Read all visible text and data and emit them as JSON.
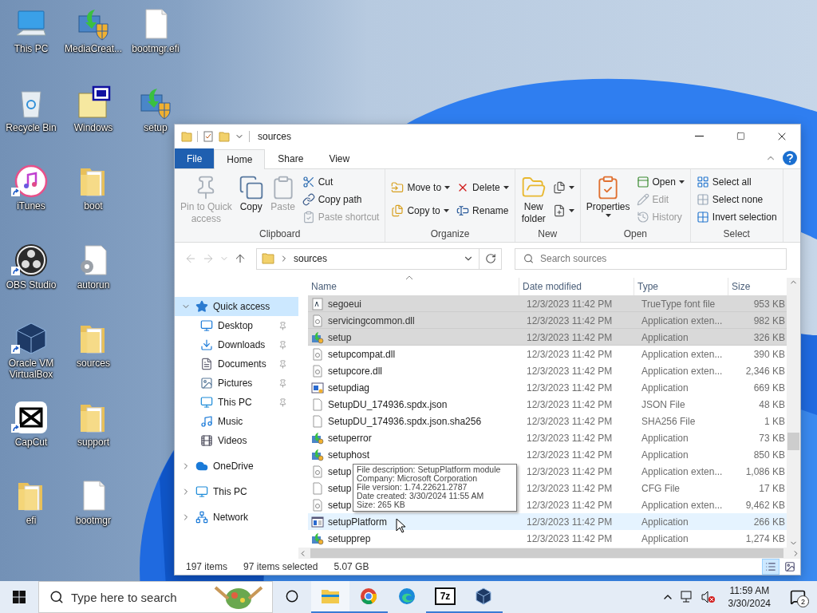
{
  "desktop": {
    "icons": [
      {
        "label": "This PC",
        "kind": "pc",
        "shortcut": false
      },
      {
        "label": "Recycle Bin",
        "kind": "recycle",
        "shortcut": false
      },
      {
        "label": "iTunes",
        "kind": "music",
        "shortcut": true
      },
      {
        "label": "OBS Studio",
        "kind": "obs",
        "shortcut": true
      },
      {
        "label": "Oracle VM VirtualBox",
        "kind": "vbox",
        "shortcut": true
      },
      {
        "label": "CapCut",
        "kind": "capcut",
        "shortcut": true
      },
      {
        "label": "efi",
        "kind": "folder",
        "shortcut": false
      },
      {
        "label": "MediaCreat...",
        "kind": "installer",
        "shortcut": false
      },
      {
        "label": "Windows",
        "kind": "iso",
        "shortcut": false
      },
      {
        "label": "boot",
        "kind": "folder",
        "shortcut": false
      },
      {
        "label": "autorun",
        "kind": "gearfile",
        "shortcut": false
      },
      {
        "label": "sources",
        "kind": "folder",
        "shortcut": false
      },
      {
        "label": "support",
        "kind": "folder",
        "shortcut": false
      },
      {
        "label": "bootmgr",
        "kind": "file",
        "shortcut": false
      },
      {
        "label": "bootmgr.efi",
        "kind": "file",
        "shortcut": false
      },
      {
        "label": "setup",
        "kind": "installer",
        "shortcut": false
      }
    ]
  },
  "window": {
    "title": "sources",
    "tabs": [
      {
        "label": "File",
        "kind": "file",
        "selected": false
      },
      {
        "label": "Home",
        "kind": "tab",
        "selected": true
      },
      {
        "label": "Share",
        "kind": "tab",
        "selected": false
      },
      {
        "label": "View",
        "kind": "tab",
        "selected": false
      }
    ],
    "ribbon": {
      "groups": [
        {
          "label": "Clipboard",
          "columns": [
            {
              "kind": "large",
              "buttons": [
                {
                  "lines": [
                    "Pin to Quick",
                    "access"
                  ],
                  "disabled": true,
                  "dropdown": false
                }
              ]
            },
            {
              "kind": "large",
              "buttons": [
                {
                  "lines": [
                    "Copy"
                  ],
                  "disabled": false,
                  "dropdown": false
                }
              ]
            },
            {
              "kind": "large",
              "buttons": [
                {
                  "lines": [
                    "Paste"
                  ],
                  "disabled": true,
                  "dropdown": false
                }
              ]
            },
            {
              "kind": "small",
              "buttons": [
                {
                  "label": "Cut",
                  "disabled": false,
                  "dropdown": false
                },
                {
                  "label": "Copy path",
                  "disabled": false,
                  "dropdown": false
                },
                {
                  "label": "Paste shortcut",
                  "disabled": true,
                  "dropdown": false
                }
              ]
            }
          ]
        },
        {
          "label": "Organize",
          "columns": [
            {
              "kind": "small",
              "buttons": [
                {
                  "label": "Move to",
                  "disabled": false,
                  "dropdown": true
                },
                {
                  "label": "Copy to",
                  "disabled": false,
                  "dropdown": true
                }
              ]
            },
            {
              "kind": "small",
              "buttons": [
                {
                  "label": "Delete",
                  "disabled": false,
                  "dropdown": true
                },
                {
                  "label": "Rename",
                  "disabled": false,
                  "dropdown": false
                }
              ]
            }
          ]
        },
        {
          "label": "New",
          "columns": [
            {
              "kind": "large",
              "buttons": [
                {
                  "lines": [
                    "New",
                    "folder"
                  ],
                  "disabled": false,
                  "dropdown": false
                }
              ]
            },
            {
              "kind": "small",
              "buttons": [
                {
                  "disabled": false,
                  "dropdown": true
                },
                {
                  "disabled": false,
                  "dropdown": true
                }
              ]
            }
          ]
        },
        {
          "label": "Open",
          "columns": [
            {
              "kind": "large",
              "buttons": [
                {
                  "lines": [
                    "Properties"
                  ],
                  "disabled": false,
                  "dropdown": true
                }
              ]
            },
            {
              "kind": "small",
              "buttons": [
                {
                  "label": "Open",
                  "disabled": false,
                  "dropdown": true
                },
                {
                  "label": "Edit",
                  "disabled": true,
                  "dropdown": false
                },
                {
                  "label": "History",
                  "disabled": true,
                  "dropdown": false
                }
              ]
            }
          ]
        },
        {
          "label": "Select",
          "columns": [
            {
              "kind": "small",
              "buttons": [
                {
                  "label": "Select all",
                  "disabled": false,
                  "dropdown": false
                },
                {
                  "label": "Select none",
                  "disabled": false,
                  "dropdown": false
                },
                {
                  "label": "Invert selection",
                  "disabled": false,
                  "dropdown": false
                }
              ]
            }
          ]
        }
      ]
    },
    "address": {
      "path": "sources",
      "search_placeholder": "Search sources"
    },
    "nav": [
      {
        "label": "Quick access",
        "kind": "star",
        "expanded": true,
        "selected": true,
        "children": [
          {
            "label": "Desktop",
            "kind": "desktop",
            "pinned": true,
            "selected": false
          },
          {
            "label": "Downloads",
            "kind": "downloads",
            "pinned": true,
            "selected": false
          },
          {
            "label": "Documents",
            "kind": "documents",
            "pinned": true,
            "selected": false
          },
          {
            "label": "Pictures",
            "kind": "pictures",
            "pinned": true,
            "selected": false
          },
          {
            "label": "This PC",
            "kind": "pc",
            "pinned": true,
            "selected": false
          },
          {
            "label": "Music",
            "kind": "music",
            "pinned": false,
            "selected": false
          },
          {
            "label": "Videos",
            "kind": "videos",
            "pinned": false,
            "selected": false
          }
        ]
      },
      {
        "label": "OneDrive",
        "kind": "cloud",
        "expanded": false,
        "selected": false
      },
      {
        "label": "This PC",
        "kind": "pc",
        "expanded": false,
        "selected": false
      },
      {
        "label": "Network",
        "kind": "network",
        "expanded": false,
        "selected": false
      }
    ],
    "files": {
      "columns": [
        "Name",
        "Date modified",
        "Type",
        "Size"
      ],
      "rows": [
        {
          "name": "segoeui",
          "kind": "font",
          "date": "12/3/2023 11:42 PM",
          "type": "TrueType font file",
          "size": "953 KB",
          "selected": true,
          "hovered": false
        },
        {
          "name": "servicingcommon.dll",
          "kind": "dll",
          "date": "12/3/2023 11:42 PM",
          "type": "Application exten...",
          "size": "982 KB",
          "selected": true,
          "hovered": false
        },
        {
          "name": "setup",
          "kind": "setup",
          "date": "12/3/2023 11:42 PM",
          "type": "Application",
          "size": "326 KB",
          "selected": true,
          "hovered": false
        },
        {
          "name": "setupcompat.dll",
          "kind": "dll",
          "date": "12/3/2023 11:42 PM",
          "type": "Application exten...",
          "size": "390 KB",
          "selected": false,
          "hovered": false
        },
        {
          "name": "setupcore.dll",
          "kind": "dll",
          "date": "12/3/2023 11:42 PM",
          "type": "Application exten...",
          "size": "2,346 KB",
          "selected": false,
          "hovered": false
        },
        {
          "name": "setupdiag",
          "kind": "diag",
          "date": "12/3/2023 11:42 PM",
          "type": "Application",
          "size": "669 KB",
          "selected": false,
          "hovered": false
        },
        {
          "name": "SetupDU_174936.spdx.json",
          "kind": "blank",
          "date": "12/3/2023 11:42 PM",
          "type": "JSON File",
          "size": "48 KB",
          "selected": false,
          "hovered": false
        },
        {
          "name": "SetupDU_174936.spdx.json.sha256",
          "kind": "blank",
          "date": "12/3/2023 11:42 PM",
          "type": "SHA256 File",
          "size": "1 KB",
          "selected": false,
          "hovered": false
        },
        {
          "name": "setuperror",
          "kind": "setup",
          "date": "12/3/2023 11:42 PM",
          "type": "Application",
          "size": "73 KB",
          "selected": false,
          "hovered": false
        },
        {
          "name": "setuphost",
          "kind": "setup",
          "date": "12/3/2023 11:42 PM",
          "type": "Application",
          "size": "850 KB",
          "selected": false,
          "hovered": false
        },
        {
          "name": "setup",
          "kind": "dll",
          "date": "12/3/2023 11:42 PM",
          "type": "Application exten...",
          "size": "1,086 KB",
          "selected": false,
          "hovered": false
        },
        {
          "name": "setup",
          "kind": "blank",
          "date": "12/3/2023 11:42 PM",
          "type": "CFG File",
          "size": "17 KB",
          "selected": false,
          "hovered": false
        },
        {
          "name": "setup",
          "kind": "dll",
          "date": "12/3/2023 11:42 PM",
          "type": "Application exten...",
          "size": "9,462 KB",
          "selected": false,
          "hovered": false
        },
        {
          "name": "setupPlatform",
          "kind": "platform",
          "date": "12/3/2023 11:42 PM",
          "type": "Application",
          "size": "266 KB",
          "selected": false,
          "hovered": true
        },
        {
          "name": "setupprep",
          "kind": "setup",
          "date": "12/3/2023 11:42 PM",
          "type": "Application",
          "size": "1,274 KB",
          "selected": false,
          "hovered": false
        }
      ]
    },
    "tooltip": [
      "File description: SetupPlatform module",
      "Company: Microsoft Corporation",
      "File version: 1.74.22621.2787",
      "Date created: 3/30/2024 11:55 AM",
      "Size: 265 KB"
    ],
    "status_bar": {
      "items": "197 items",
      "selection": "97 items selected",
      "selection_size": "5.07 GB",
      "views": [
        {
          "kind": "details",
          "selected": true
        },
        {
          "kind": "tiles",
          "selected": false
        }
      ]
    }
  },
  "taskbar": {
    "search_placeholder": "Type here to search",
    "apps": [
      {
        "kind": "explorer",
        "running": true,
        "active": true
      },
      {
        "kind": "chrome",
        "running": true,
        "active": false
      },
      {
        "kind": "edge",
        "running": false,
        "active": false
      },
      {
        "kind": "sevenzip",
        "label": "7z",
        "running": true,
        "active": false
      },
      {
        "kind": "vbox",
        "running": true,
        "active": false
      }
    ],
    "tray": {
      "muted": true,
      "time": "11:59 AM",
      "date": "3/30/2024",
      "notifications": "2"
    }
  }
}
